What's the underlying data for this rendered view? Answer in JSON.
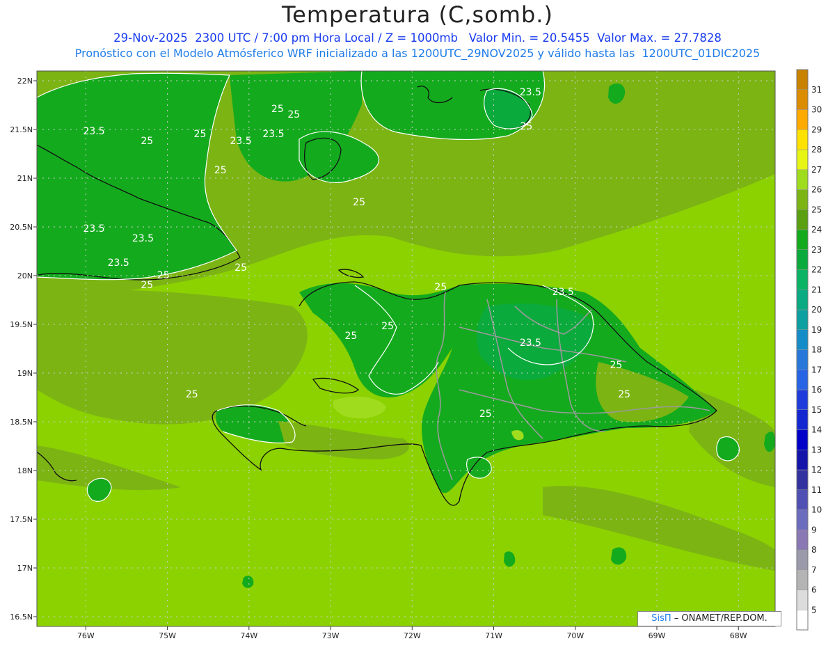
{
  "title": "Temperatura (C,somb.)",
  "subtitle1": "29-Nov-2025  2300 UTC / 7:00 pm Hora Local / Z = 1000mb   Valor Min. = 20.5455  Valor Max. = 27.7828",
  "subtitle2": "Pronóstico con el Modelo Atmósferico WRF inicializado a las 1200UTC_29NOV2025 y válido hasta las  1200UTC_01DIC2025",
  "credit": {
    "brand": "SisΠ",
    "text": "– ONAMET/REP.DOM."
  },
  "axes": {
    "y_ticks": [
      "22N",
      "21.5N",
      "21N",
      "20.5N",
      "20N",
      "19.5N",
      "19N",
      "18.5N",
      "18N",
      "17.5N",
      "17N",
      "16.5N"
    ],
    "x_ticks": [
      "76W",
      "75W",
      "74W",
      "73W",
      "72W",
      "71W",
      "70W",
      "69W",
      "68W"
    ]
  },
  "contour_labels": [
    {
      "text": "23.5",
      "lon": -75.9,
      "lat": 21.45
    },
    {
      "text": "25",
      "lon": -75.25,
      "lat": 21.35
    },
    {
      "text": "25",
      "lon": -74.6,
      "lat": 21.42
    },
    {
      "text": "23.5",
      "lon": -74.1,
      "lat": 21.35
    },
    {
      "text": "25",
      "lon": -74.35,
      "lat": 21.05
    },
    {
      "text": "25",
      "lon": -73.65,
      "lat": 21.68
    },
    {
      "text": "25",
      "lon": -73.45,
      "lat": 21.62
    },
    {
      "text": "23.5",
      "lon": -73.7,
      "lat": 21.42
    },
    {
      "text": "25",
      "lon": -72.65,
      "lat": 20.72
    },
    {
      "text": "23.5",
      "lon": -70.55,
      "lat": 21.85
    },
    {
      "text": "25",
      "lon": -70.6,
      "lat": 21.5
    },
    {
      "text": "23.5",
      "lon": -75.9,
      "lat": 20.45
    },
    {
      "text": "23.5",
      "lon": -75.3,
      "lat": 20.35
    },
    {
      "text": "23.5",
      "lon": -75.6,
      "lat": 20.1
    },
    {
      "text": "25",
      "lon": -74.1,
      "lat": 20.05
    },
    {
      "text": "25",
      "lon": -75.25,
      "lat": 19.87
    },
    {
      "text": "25",
      "lon": -75.05,
      "lat": 19.97
    },
    {
      "text": "25",
      "lon": -71.65,
      "lat": 19.85
    },
    {
      "text": "23.5",
      "lon": -70.15,
      "lat": 19.8
    },
    {
      "text": "25",
      "lon": -72.3,
      "lat": 19.45
    },
    {
      "text": "25",
      "lon": -72.75,
      "lat": 19.35
    },
    {
      "text": "23.5",
      "lon": -70.55,
      "lat": 19.28
    },
    {
      "text": "25",
      "lon": -69.5,
      "lat": 19.05
    },
    {
      "text": "25",
      "lon": -69.4,
      "lat": 18.75
    },
    {
      "text": "25",
      "lon": -74.7,
      "lat": 18.75
    },
    {
      "text": "25",
      "lon": -71.1,
      "lat": 18.55
    }
  ],
  "colorbar": {
    "levels": [
      "5",
      "6",
      "7",
      "8",
      "9",
      "10",
      "11",
      "12",
      "13",
      "14",
      "15",
      "16",
      "17",
      "18",
      "19",
      "20",
      "21",
      "22",
      "23",
      "24",
      "25",
      "26",
      "27",
      "28",
      "29",
      "30",
      "31"
    ],
    "colors": [
      "#ffffff",
      "#dcdcdc",
      "#b4b4b4",
      "#9a9aaa",
      "#8a78b4",
      "#6c6cbe",
      "#5050b4",
      "#3232a0",
      "#1414aa",
      "#0000c8",
      "#1428d2",
      "#1e3cdc",
      "#2864e6",
      "#2878dc",
      "#148cc8",
      "#0ca0a0",
      "#0aaa82",
      "#0ab464",
      "#0aaa3c",
      "#14aa1e",
      "#5aa010",
      "#7cb414",
      "#a0dc1e",
      "#e6f514",
      "#ffe100",
      "#ffaa00",
      "#dc8c00",
      "#c88200"
    ]
  },
  "colors": {
    "sea_warm": "#8cd200",
    "sea_mid": "#7cb414",
    "land_cool": "#14aa1e",
    "land_cooler": "#0aaa3c",
    "hot": "#a0dc1e"
  }
}
